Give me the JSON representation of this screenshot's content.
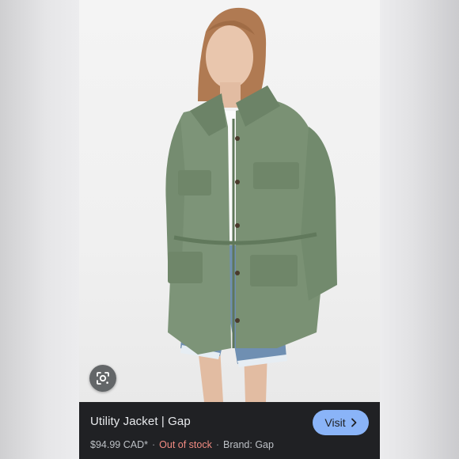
{
  "product": {
    "title": "Utility Jacket | Gap",
    "price": "$94.99 CAD*",
    "separator": "·",
    "stock_status": "Out of stock",
    "brand": "Brand: Gap"
  },
  "actions": {
    "visit_label": "Visit",
    "visit_icon": "chevron-right-icon",
    "lens_icon": "lens-search-icon"
  },
  "colors": {
    "panel_bg": "#202124",
    "visit_button": "#8ab4f8",
    "out_of_stock": "#f28b82",
    "jacket": "#7d9478"
  }
}
